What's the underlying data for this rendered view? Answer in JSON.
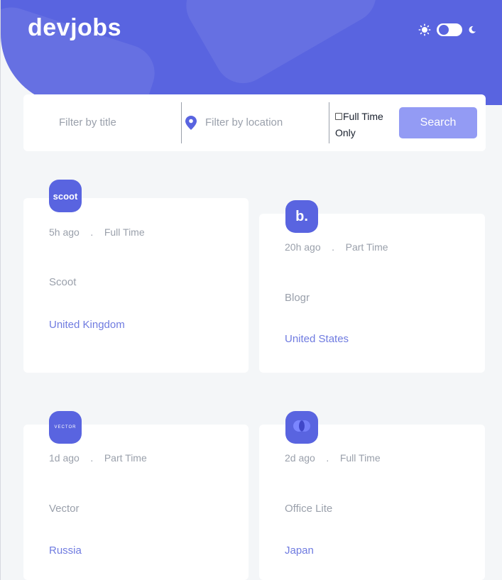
{
  "header": {
    "logo": "devjobs",
    "theme": {
      "sun_icon": "sun-icon",
      "moon_icon": "moon-icon",
      "mode": "light"
    },
    "background_color": "#5964e0"
  },
  "search": {
    "title_placeholder": "Filter by title",
    "location_placeholder": "Filter by location",
    "fulltime_label": "Full Time Only",
    "fulltime_checked": false,
    "button_label": "Search",
    "button_color": "#939bf4"
  },
  "jobs": [
    {
      "logo_text": "scoot",
      "logo_color": "#5964e0",
      "posted": "5h ago",
      "sep": ".",
      "contract": "Full Time",
      "company": "Scoot",
      "location": "United Kingdom"
    },
    {
      "logo_text": "b.",
      "logo_color": "#5964e0",
      "posted": "20h ago",
      "sep": ".",
      "contract": "Part Time",
      "company": "Blogr",
      "location": "United States"
    },
    {
      "logo_text": "VECTOR",
      "logo_color": "#5964e0",
      "posted": "1d ago",
      "sep": ".",
      "contract": "Part Time",
      "company": "Vector",
      "location": "Russia"
    },
    {
      "logo_text": "",
      "logo_icon": "office-lite-icon",
      "logo_color": "#5964e0",
      "posted": "2d ago",
      "sep": ".",
      "contract": "Full Time",
      "company": "Office Lite",
      "location": "Japan"
    }
  ]
}
